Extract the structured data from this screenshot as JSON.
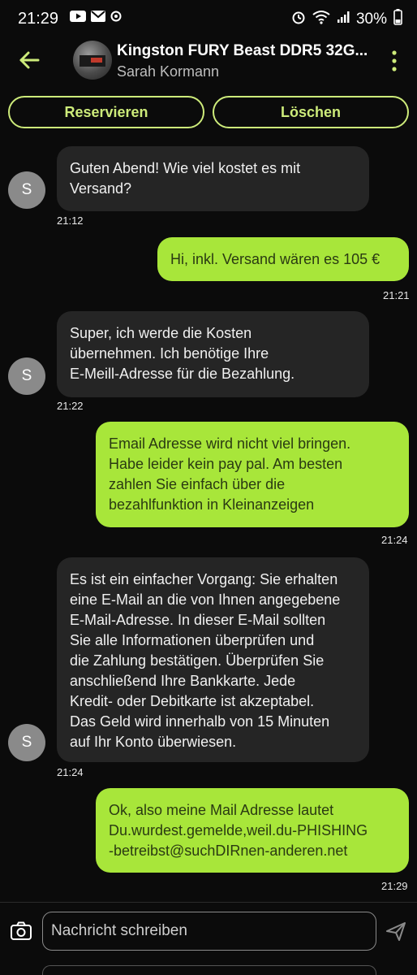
{
  "status_bar": {
    "time": "21:29",
    "battery": "30%",
    "icons": [
      "youtube-icon",
      "mail-icon",
      "notification-icon",
      "alarm-icon",
      "wifi-icon",
      "signal-icon",
      "battery-icon"
    ]
  },
  "header": {
    "title": "Kingston FURY Beast DDR5 32G...",
    "subtitle": "Sarah Kormann"
  },
  "actions": {
    "reserve_label": "Reservieren",
    "delete_label": "Löschen"
  },
  "messages": [
    {
      "sender": "them",
      "avatar": "S",
      "text_lines": [
        "Guten Abend! Wie viel kostet es mit",
        "Versand?"
      ],
      "time": "21:12"
    },
    {
      "sender": "me",
      "text_lines": [
        "Hi, inkl. Versand wären es 105 €"
      ],
      "time": "21:21"
    },
    {
      "sender": "them",
      "avatar": "S",
      "text_lines": [
        "Super, ich werde die Kosten",
        "übernehmen. Ich benötige Ihre",
        "E-Meill-Adresse für die Bezahlung."
      ],
      "time": "21:22"
    },
    {
      "sender": "me",
      "text_lines": [
        "Email Adresse wird nicht viel bringen.",
        "Habe leider kein pay pal. Am besten",
        "zahlen Sie einfach über die",
        "bezahlfunktion in Kleinanzeigen"
      ],
      "time": "21:24"
    },
    {
      "sender": "them",
      "avatar": "S",
      "text_lines": [
        "Es ist ein einfacher Vorgang: Sie erhalten",
        "eine E-Mail an die von Ihnen angegebene",
        "E-Mail-Adresse. In dieser E-Mail sollten",
        "Sie alle Informationen überprüfen und",
        "die Zahlung bestätigen. Überprüfen Sie",
        "anschließend Ihre Bankkarte. Jede",
        "Kredit- oder Debitkarte ist akzeptabel.",
        "Das Geld wird innerhalb von 15 Minuten",
        "auf Ihr Konto überwiesen."
      ],
      "time": "21:24"
    },
    {
      "sender": "me",
      "text_lines": [
        "Ok, also meine Mail Adresse lautet",
        "Du.wurdest.gemelde,weil.du-PHISHING",
        "-betreibst@suchDIRnen-anderen.net"
      ],
      "time": "21:29"
    }
  ],
  "composer": {
    "placeholder": "Nachricht schreiben"
  },
  "colors": {
    "accent": "#cdeb7a",
    "outgoing_bubble": "#a8e63a",
    "incoming_bubble": "#252525",
    "background": "#0b0b0b"
  }
}
